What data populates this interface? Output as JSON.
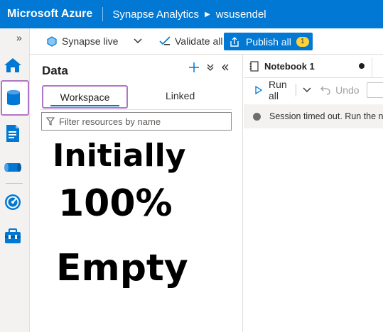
{
  "topbar": {
    "brand": "Microsoft Azure",
    "service": "Synapse Analytics",
    "workspace": "wsusendel"
  },
  "toolbar": {
    "mode": "Synapse live",
    "validate": "Validate all",
    "publish": "Publish all",
    "publish_count": "1"
  },
  "rail": {
    "expand_glyph": "»",
    "items": [
      "home-icon",
      "data-icon",
      "develop-icon",
      "integrate-icon",
      "monitor-icon",
      "manage-icon"
    ],
    "selected": "data-icon"
  },
  "data_panel": {
    "title": "Data",
    "tabs": [
      "Workspace",
      "Linked"
    ],
    "active_tab": "Workspace",
    "filter_placeholder": "Filter resources by name",
    "annotation": [
      "Initially",
      "100%",
      "Empty"
    ]
  },
  "notebook": {
    "tab_label": "Notebook 1",
    "run_all": "Run all",
    "undo": "Undo",
    "session_message": "Session timed out. Run the notebook to start a new session."
  },
  "colors": {
    "azure_blue": "#0078d4",
    "highlight": "#b076c6",
    "badge": "#ffd335"
  }
}
